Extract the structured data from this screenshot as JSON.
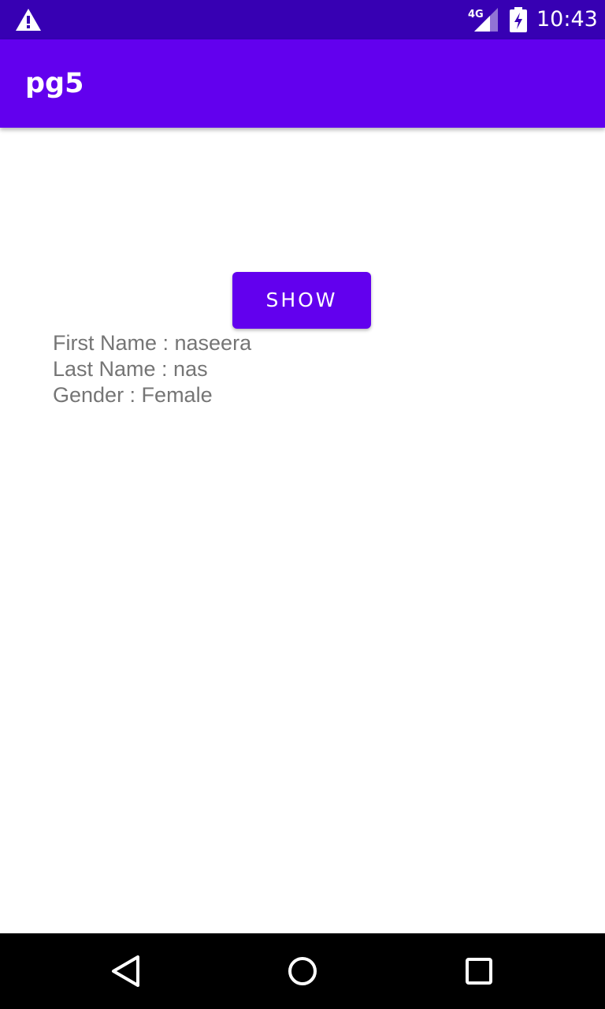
{
  "status_bar": {
    "time": "10:43",
    "network_label": "4G",
    "icons": [
      "warning-icon",
      "signal-icon",
      "battery-charging-icon"
    ]
  },
  "app_bar": {
    "title": "pg5"
  },
  "main": {
    "show_button_label": "SHOW",
    "lines": [
      "First Name : naseera",
      "Last Name : nas",
      "Gender : Female"
    ]
  },
  "nav_bar": {
    "icons": [
      "back-icon",
      "home-icon",
      "recents-icon"
    ]
  },
  "colors": {
    "status_bar": "#3700b3",
    "primary": "#6200ee",
    "text_secondary": "#757575",
    "nav_bar": "#000000"
  }
}
